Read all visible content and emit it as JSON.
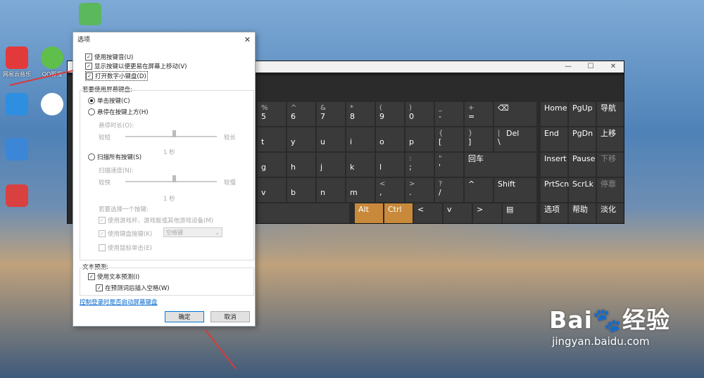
{
  "desktop": {
    "icons": [
      {
        "label": "网易云音乐",
        "color": "#e23a3a"
      },
      {
        "label": "QQ影视",
        "color": "#5fbf4a"
      },
      {
        "label": "",
        "color": "#2e8ee0"
      },
      {
        "label": "",
        "color": "#ffffff"
      }
    ]
  },
  "keyboard": {
    "title_buttons": [
      "—",
      "☐",
      "✕"
    ],
    "rows": [
      [
        "5",
        "6",
        "7",
        "8",
        "9",
        "0",
        "-",
        "="
      ],
      [
        "t",
        "y",
        "u",
        "i",
        "o",
        "p",
        "[",
        "]",
        "\\",
        "Del"
      ],
      [
        "g",
        "h",
        "j",
        "k",
        "l",
        ";",
        "'",
        "回车"
      ],
      [
        "v",
        "b",
        "n",
        "m",
        ",",
        ".",
        "/",
        "^",
        "Shift"
      ],
      [
        "Alt",
        "Ctrl",
        "<",
        "v",
        ">"
      ]
    ],
    "row1_tops": [
      "%",
      "^",
      "&",
      "*",
      "(",
      ")",
      "_",
      "+"
    ],
    "nav": [
      [
        "Home",
        "PgUp",
        "导航"
      ],
      [
        "End",
        "PgDn",
        "上移"
      ],
      [
        "Insert",
        "Pause",
        "下移"
      ],
      [
        "PrtScn",
        "ScrLk",
        "停靠"
      ],
      [
        "选项",
        "帮助",
        "淡化"
      ]
    ]
  },
  "dialog": {
    "title": "选项",
    "close": "✕",
    "opt_sound": "使用按键音(U)",
    "opt_show_keys": "显示按键以便更易在屏幕上移动(V)",
    "opt_numpad": "打开数字小键盘(D)",
    "group_label": "若要使用屏幕键盘:",
    "radio_click": "单击按键(C)",
    "radio_hover": "悬停在按键上方(H)",
    "hover_time_label": "悬停时长(O):",
    "short": "较短",
    "long": "较长",
    "hover_value": "1 秒",
    "radio_scan": "扫描所有按键(S)",
    "scan_speed_label": "扫描速度(N):",
    "slow": "较快",
    "fast": "较慢",
    "scan_value": "1 秒",
    "select_key_label": "若要选择一个按键:",
    "opt_joystick": "使用游戏杆、游戏板或其他游戏设备(M)",
    "opt_keyboard_key": "使用键盘按键(K)",
    "key_select_value": "空格键",
    "opt_mouse_click": "使用鼠标单击(E)",
    "text_pred_label": "文本预测:",
    "opt_text_pred": "使用文本预测(I)",
    "opt_insert_space": "在预测词后插入空格(W)",
    "link": "控制登录时是否启动屏幕键盘",
    "ok": "确定",
    "cancel": "取消"
  },
  "watermark": {
    "brand": "Bai",
    "brand2": "经验",
    "url": "jingyan.baidu.com"
  }
}
